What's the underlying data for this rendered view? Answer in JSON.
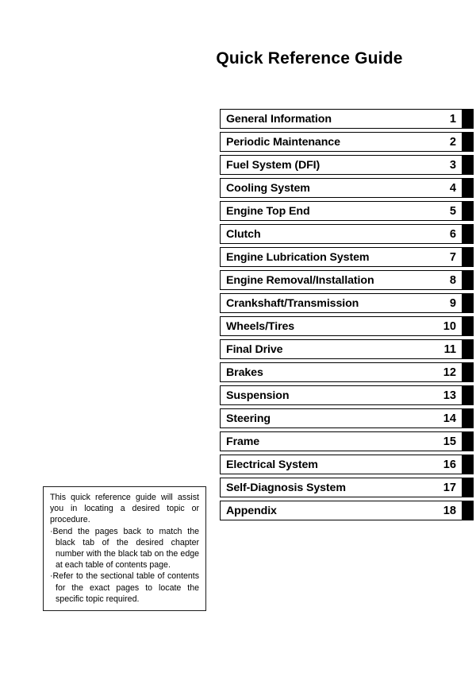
{
  "page": {
    "title": "Quick Reference Guide"
  },
  "chapters": [
    {
      "label": "General Information",
      "number": "1"
    },
    {
      "label": "Periodic Maintenance",
      "number": "2"
    },
    {
      "label": "Fuel System (DFI)",
      "number": "3"
    },
    {
      "label": "Cooling System",
      "number": "4"
    },
    {
      "label": "Engine Top End",
      "number": "5"
    },
    {
      "label": "Clutch",
      "number": "6"
    },
    {
      "label": "Engine Lubrication System",
      "number": "7"
    },
    {
      "label": "Engine Removal/Installation",
      "number": "8"
    },
    {
      "label": "Crankshaft/Transmission",
      "number": "9"
    },
    {
      "label": "Wheels/Tires",
      "number": "10"
    },
    {
      "label": "Final Drive",
      "number": "11"
    },
    {
      "label": "Brakes",
      "number": "12"
    },
    {
      "label": "Suspension",
      "number": "13"
    },
    {
      "label": "Steering",
      "number": "14"
    },
    {
      "label": "Frame",
      "number": "15"
    },
    {
      "label": "Electrical System",
      "number": "16"
    },
    {
      "label": "Self-Diagnosis System",
      "number": "17"
    },
    {
      "label": "Appendix",
      "number": "18"
    }
  ],
  "note": {
    "intro": "This quick reference guide will assist you in locating a desired topic or procedure.",
    "bullet_mark": "·",
    "bullets": [
      "Bend the pages back to match the black tab of the desired chapter number with the black tab on the edge at each table of contents page.",
      "Refer to the sectional table of contents for the exact pages to locate the specific topic required."
    ]
  },
  "colors": {
    "ink": "#000000",
    "page_background": "#ffffff",
    "tab": "#000000",
    "note_border": "#1c1c1c"
  }
}
